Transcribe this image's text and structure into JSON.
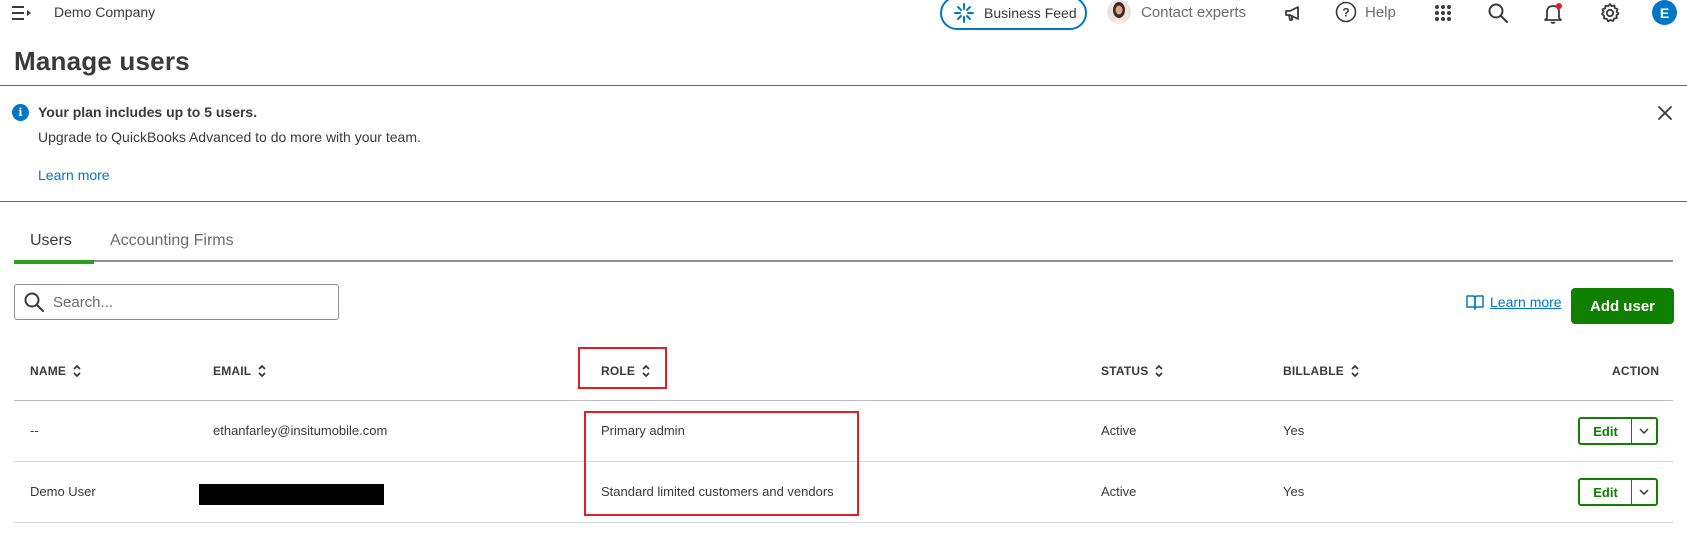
{
  "topbar": {
    "company": "Demo Company",
    "business_feed": "Business Feed",
    "contact_experts": "Contact experts",
    "help": "Help",
    "user_initial": "E"
  },
  "page": {
    "title": "Manage users"
  },
  "banner": {
    "title": "Your plan includes up to 5 users.",
    "text": "Upgrade to QuickBooks Advanced to do more with your team.",
    "link": "Learn more"
  },
  "tabs": [
    {
      "label": "Users",
      "active": true
    },
    {
      "label": "Accounting Firms",
      "active": false
    }
  ],
  "toolbar": {
    "search_placeholder": "Search...",
    "learn_more": "Learn more",
    "add_user": "Add user"
  },
  "table": {
    "columns": [
      "NAME",
      "EMAIL",
      "ROLE",
      "STATUS",
      "BILLABLE",
      "ACTION"
    ],
    "rows": [
      {
        "name": "--",
        "email": "ethanfarley@insitumobile.com",
        "role": "Primary admin",
        "status": "Active",
        "billable": "Yes",
        "action": "Edit"
      },
      {
        "name": "Demo User",
        "email": "",
        "role": "Standard limited customers and vendors",
        "status": "Active",
        "billable": "Yes",
        "action": "Edit"
      }
    ]
  },
  "colors": {
    "accent": "#0077c5",
    "primary_green": "#108000",
    "tab_green": "#2ca01c",
    "highlight": "#e31e24",
    "divider_teal": "#1f8582"
  }
}
